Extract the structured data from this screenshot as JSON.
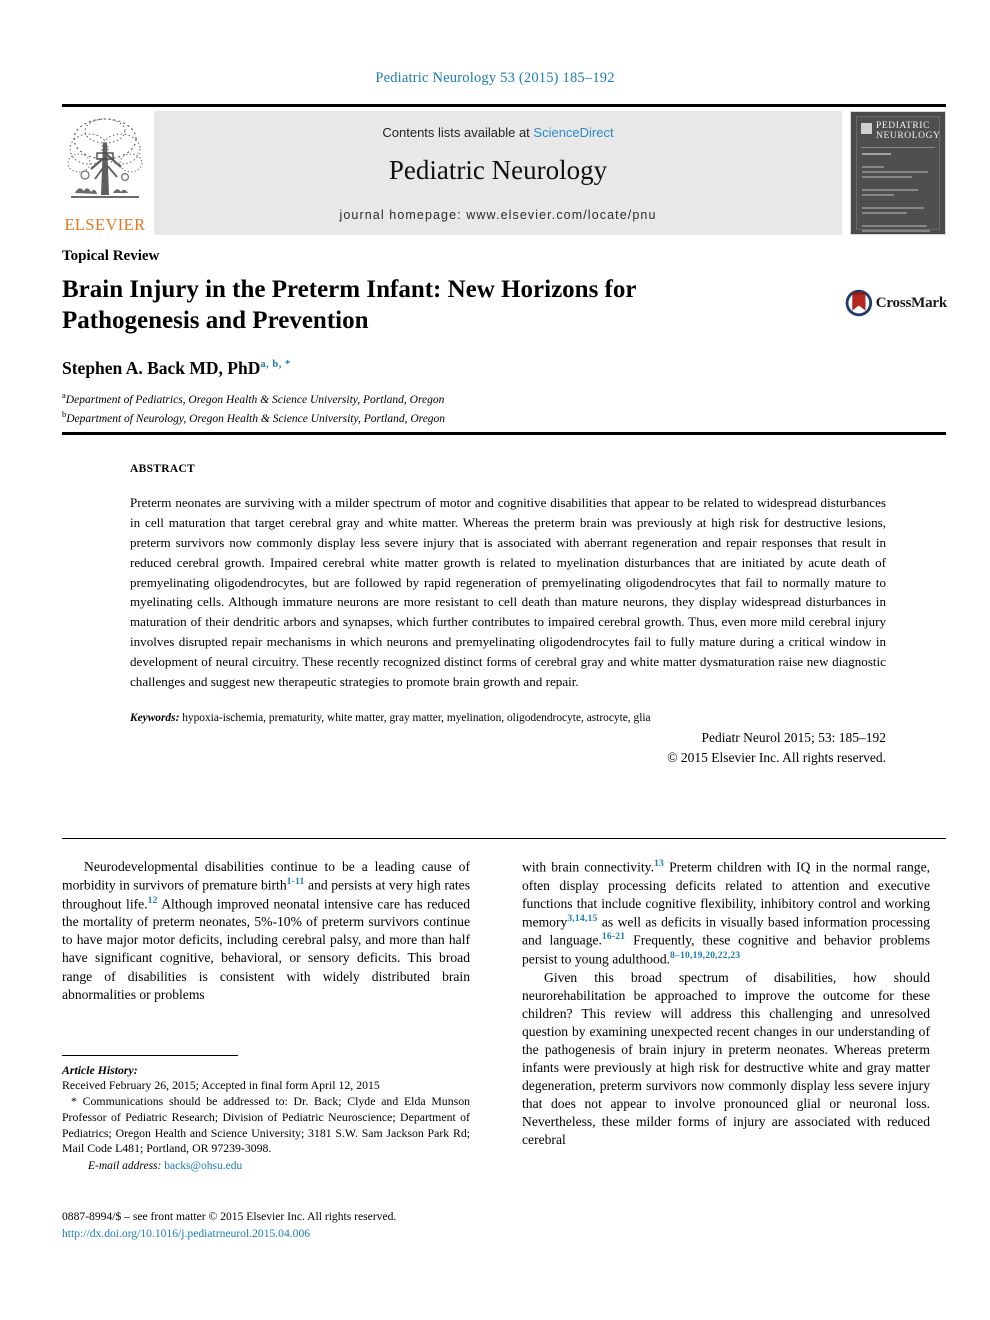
{
  "running_head": "Pediatric Neurology 53 (2015) 185–192",
  "masthead": {
    "contents_prefix": "Contents lists available at ",
    "sciencedirect": "ScienceDirect",
    "journal_name": "Pediatric Neurology",
    "homepage": "journal homepage: www.elsevier.com/locate/pnu",
    "publisher_wordmark": "ELSEVIER",
    "cover_title_line1": "PEDIATRIC",
    "cover_title_line2": "NEUROLOGY",
    "accent_link_color": "#2c8bcb",
    "publisher_color": "#e87722",
    "banner_color": "#e8e8e8"
  },
  "article": {
    "section_type": "Topical Review",
    "title": "Brain Injury in the Preterm Infant: New Horizons for Pathogenesis and Prevention",
    "author": "Stephen A. Back MD, PhD",
    "author_marks": "a, b, *",
    "affiliation_a_marker": "a",
    "affiliation_a": "Department of Pediatrics, Oregon Health & Science University, Portland, Oregon",
    "affiliation_b_marker": "b",
    "affiliation_b": "Department of Neurology, Oregon Health & Science University, Portland, Oregon",
    "crossmark_label": "CrossMark"
  },
  "abstract": {
    "label": "ABSTRACT",
    "text": "Preterm neonates are surviving with a milder spectrum of motor and cognitive disabilities that appear to be related to widespread disturbances in cell maturation that target cerebral gray and white matter. Whereas the preterm brain was previously at high risk for destructive lesions, preterm survivors now commonly display less severe injury that is associated with aberrant regeneration and repair responses that result in reduced cerebral growth. Impaired cerebral white matter growth is related to myelination disturbances that are initiated by acute death of premyelinating oligodendrocytes, but are followed by rapid regeneration of premyelinating oligodendrocytes that fail to normally mature to myelinating cells. Although immature neurons are more resistant to cell death than mature neurons, they display widespread disturbances in maturation of their dendritic arbors and synapses, which further contributes to impaired cerebral growth. Thus, even more mild cerebral injury involves disrupted repair mechanisms in which neurons and premyelinating oligodendrocytes fail to fully mature during a critical window in development of neural circuitry. These recently recognized distinct forms of cerebral gray and white matter dysmaturation raise new diagnostic challenges and suggest new therapeutic strategies to promote brain growth and repair.",
    "keywords_label": "Keywords:",
    "keywords": " hypoxia-ischemia, prematurity, white matter, gray matter, myelination, oligodendrocyte, astrocyte, glia",
    "citation": "Pediatr Neurol 2015; 53: 185–192",
    "copyright": "© 2015 Elsevier Inc. All rights reserved."
  },
  "body": {
    "left": {
      "p1_a": "Neurodevelopmental disabilities continue to be a leading cause of morbidity in survivors of premature birth",
      "p1_ref1": "1-11",
      "p1_b": " and persists at very high rates throughout life.",
      "p1_ref2": "12",
      "p1_c": " Although improved neonatal intensive care has reduced the mortality of preterm neonates, 5%-10% of preterm survivors continue to have major motor deficits, including cerebral palsy, and more than half have significant cognitive, behavioral, or sensory deficits. This broad range of disabilities is consistent with widely distributed brain abnormalities or problems"
    },
    "right": {
      "p1_a": "with brain connectivity.",
      "p1_ref1": "13",
      "p1_b": " Preterm children with IQ in the normal range, often display processing deficits related to attention and executive functions that include cognitive flexibility, inhibitory control and working memory",
      "p1_ref2": "3,14,15",
      "p1_c": " as well as deficits in visually based information processing and language.",
      "p1_ref3": "16-21",
      "p1_d": " Frequently, these cognitive and behavior problems persist to young adulthood.",
      "p1_ref4": "8–10,19,20,22,23",
      "p2": "Given this broad spectrum of disabilities, how should neurorehabilitation be approached to improve the outcome for these children? This review will address this challenging and unresolved question by examining unexpected recent changes in our understanding of the pathogenesis of brain injury in preterm neonates. Whereas preterm infants were previously at high risk for destructive white and gray matter degeneration, preterm survivors now commonly display less severe injury that does not appear to involve pronounced glial or neuronal loss. Nevertheless, these milder forms of injury are associated with reduced cerebral"
    }
  },
  "footnote": {
    "history_label": "Article History:",
    "history": "Received February 26, 2015; Accepted in final form April 12, 2015",
    "correspondence": "* Communications should be addressed to: Dr. Back; Clyde and Elda Munson Professor of Pediatric Research; Division of Pediatric Neuroscience; Department of Pediatrics; Oregon Health and Science University; 3181 S.W. Sam Jackson Park Rd; Mail Code L481; Portland, OR 97239-3098.",
    "email_label": "E-mail address:",
    "email": "backs@ohsu.edu"
  },
  "footer": {
    "issn_line": "0887-8994/$ – see front matter © 2015 Elsevier Inc. All rights reserved.",
    "doi": "http://dx.doi.org/10.1016/j.pediatrneurol.2015.04.006"
  }
}
